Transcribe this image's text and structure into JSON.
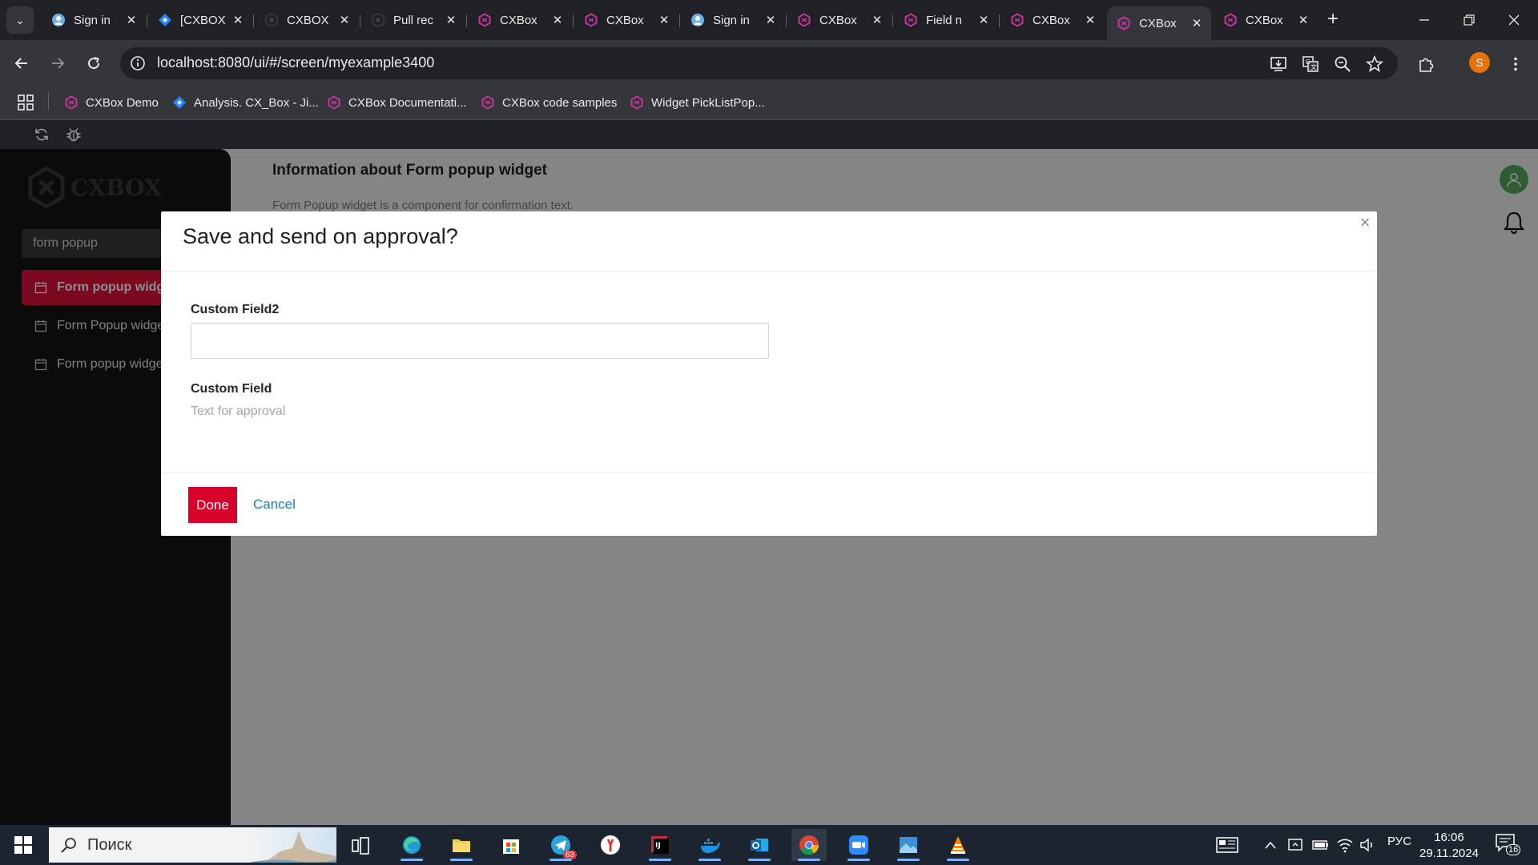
{
  "browser": {
    "tabs": [
      {
        "title": "Sign in",
        "favicon": "sign-in-favicon"
      },
      {
        "title": "[CXBOX",
        "favicon": "jira-favicon"
      },
      {
        "title": "CXBOX",
        "favicon": "github-favicon"
      },
      {
        "title": "Pull rec",
        "favicon": "github-favicon"
      },
      {
        "title": "CXBox",
        "favicon": "cxbox-favicon"
      },
      {
        "title": "CXBox",
        "favicon": "cxbox-favicon"
      },
      {
        "title": "Sign in",
        "favicon": "sign-in-favicon"
      },
      {
        "title": "CXBox",
        "favicon": "cxbox-favicon"
      },
      {
        "title": "Field n",
        "favicon": "cxbox-favicon"
      },
      {
        "title": "CXBox",
        "favicon": "cxbox-favicon"
      },
      {
        "title": "CXBox",
        "favicon": "cxbox-favicon"
      },
      {
        "title": "CXBox",
        "favicon": "cxbox-favicon"
      }
    ],
    "active_tab_index": 10,
    "new_tab_symbol": "+",
    "close_symbol": "✕",
    "url": "localhost:8080/ui/#/screen/myexample3400",
    "profile_initial": "S",
    "profile_color": "#e8710a",
    "bookmarks": [
      {
        "label": "CXBox Demo",
        "icon": "cxbox-icon"
      },
      {
        "label": "Analysis. CX_Box - Ji...",
        "icon": "jira-icon"
      },
      {
        "label": "CXBox Documentati...",
        "icon": "cxbox-icon"
      },
      {
        "label": "CXBox code samples",
        "icon": "cxbox-icon"
      },
      {
        "label": "Widget PickListPop...",
        "icon": "cxbox-icon"
      }
    ]
  },
  "app": {
    "logo_text": "CXBOX",
    "search_value": "form popup",
    "menu": [
      {
        "label": "Form popup widget",
        "selected": true
      },
      {
        "label": "Form Popup widget",
        "selected": false
      },
      {
        "label": "Form popup widget",
        "selected": false
      }
    ],
    "accent_color": "#e0123a",
    "page_title": "Information about Form popup widget",
    "page_description": "Form Popup widget is a component for confirmation text."
  },
  "modal": {
    "title": "Save and send on approval?",
    "close_symbol": "×",
    "fields": [
      {
        "label": "Custom Field2",
        "value": ""
      },
      {
        "label": "Custom Field",
        "value": "Text for approval"
      }
    ],
    "done_label": "Done",
    "cancel_label": "Cancel"
  },
  "taskbar": {
    "search_placeholder": "Поиск",
    "apps": [
      "task-view",
      "edge",
      "file-explorer",
      "store",
      "telegram",
      "yandex-browser",
      "intellij-idea",
      "docker",
      "outlook",
      "chrome",
      "zoom",
      "photos",
      "vlc"
    ],
    "telegram_badge": "63",
    "language": "РУС",
    "time": "16:06",
    "date": "29.11.2024",
    "notifications_count": "16"
  }
}
